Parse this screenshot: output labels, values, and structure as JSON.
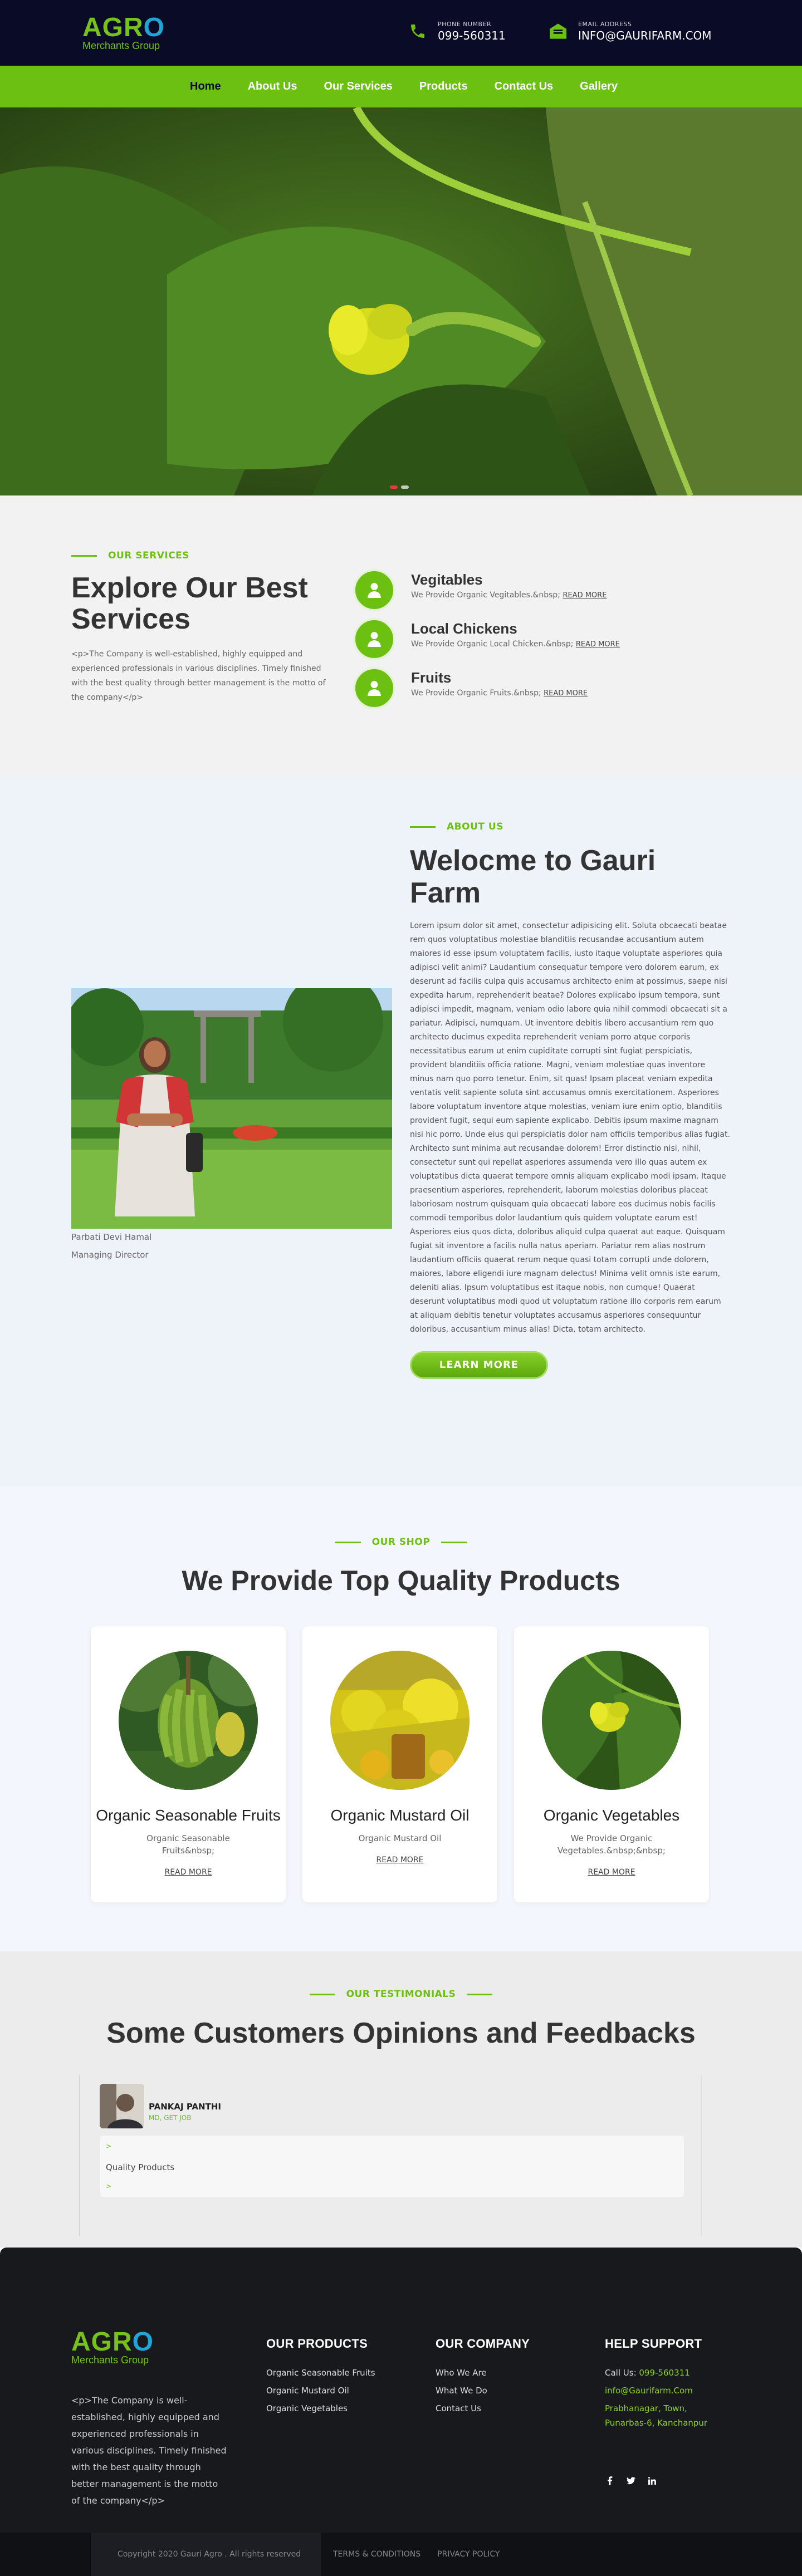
{
  "brand": {
    "logo_letters": [
      "AGR",
      "O"
    ],
    "logo_sub": "Merchants Group",
    "green": "#6cc012",
    "navy": "#0a0b26"
  },
  "header": {
    "phone_label": "PHONE NUMBER",
    "phone_value": "099-560311",
    "email_label": "EMAIL ADDRESS",
    "email_value": "INFO@GAURIFARM.COM"
  },
  "nav": {
    "items": [
      "Home",
      "About Us",
      "Our Services",
      "Products",
      "Contact Us",
      "Gallery"
    ],
    "active": "Home"
  },
  "hero": {
    "slides": 2,
    "active_slide": 1
  },
  "services": {
    "eyebrow": "OUR SERVICES",
    "title": "Explore Our Best Services",
    "text": "<p>The Company is well-established, highly equipped and experienced professionals in various disciplines. Timely finished with the best quality through better management is the motto of the company</p>",
    "items": [
      {
        "title": "Vegitables",
        "desc": "We Provide Organic Vegitables.&nbsp;",
        "link": "READ MORE"
      },
      {
        "title": "Local Chickens",
        "desc": "We Provide Organic Local Chicken.&nbsp;",
        "link": "READ MORE"
      },
      {
        "title": "Fruits",
        "desc": "We Provide Organic Fruits.&nbsp;",
        "link": "READ MORE"
      }
    ]
  },
  "about": {
    "eyebrow": "ABOUT US",
    "title": "Welocme to Gauri Farm",
    "person_name": "Parbati Devi Hamal",
    "person_role": "Managing Director",
    "text": "Lorem ipsum dolor sit amet, consectetur adipisicing elit. Soluta obcaecati beatae rem quos voluptatibus molestiae blanditiis recusandae accusantium autem maiores id esse ipsum voluptatem facilis, iusto itaque voluptate asperiores quia adipisci velit animi? Laudantium consequatur tempore vero dolorem earum, ex deserunt ad facilis culpa quis accusamus architecto enim at possimus, saepe nisi expedita harum, reprehenderit beatae? Dolores explicabo ipsum tempora, sunt adipisci impedit, magnam, veniam odio labore quia nihil commodi obcaecati sit a pariatur. Adipisci, numquam. Ut inventore debitis libero accusantium rem quo architecto ducimus expedita reprehenderit veniam porro atque corporis necessitatibus earum ut enim cupiditate corrupti sint fugiat perspiciatis, provident blanditiis officia ratione. Magni, veniam molestiae quas inventore minus nam quo porro tenetur. Enim, sit quas! Ipsam placeat veniam expedita ventatis velit sapiente soluta sint accusamus omnis exercitationem. Asperiores labore voluptatum inventore atque molestias, veniam iure enim optio, blanditiis provident fugit, sequi eum sapiente explicabo. Debitis ipsum maxime magnam nisi hic porro. Unde eius qui perspiciatis dolor nam officiis temporibus alias fugiat. Architecto sunt minima aut recusandae dolorem! Error distinctio nisi, nihil, consectetur sunt qui repellat asperiores assumenda vero illo quas autem ex voluptatibus dicta quaerat tempore omnis aliquam explicabo modi ipsam. Itaque praesentium asperiores, reprehenderit, laborum molestias doloribus placeat laboriosam nostrum quisquam quia obcaecati labore eos ducimus nobis facilis commodi temporibus dolor laudantium quis quidem voluptate earum est! Asperiores eius quos dicta, doloribus aliquid culpa quaerat aut eaque. Quisquam fugiat sit inventore a facilis nulla natus aperiam. Pariatur rem alias nostrum laudantium officiis quaerat rerum neque quasi totam corrupti unde dolorem, maiores, labore eligendi iure magnam delectus! Minima velit omnis iste earum, deleniti alias. Ipsum voluptatibus est itaque nobis, non cumque! Quaerat deserunt voluptatibus modi quod ut voluptatum ratione illo corporis rem earum at aliquam debitis tenetur voluptates accusamus asperiores consequuntur doloribus, accusantium minus alias! Dicta, totam architecto.",
    "button": "LEARN MORE"
  },
  "shop": {
    "eyebrow": "OUR SHOP",
    "title": "We Provide Top Quality Products",
    "cards": [
      {
        "title": "Organic Seasonable Fruits",
        "desc": "Organic Seasonable Fruits&nbsp;",
        "link": "READ MORE"
      },
      {
        "title": "Organic Mustard Oil",
        "desc": "Organic Mustard Oil",
        "link": "READ MORE"
      },
      {
        "title": "Organic Vegetables",
        "desc": "We Provide Organic Vegetables.&nbsp;&nbsp;",
        "link": "READ MORE"
      }
    ]
  },
  "testimonials": {
    "eyebrow": "OUR TESTIMONIALS",
    "title": "Some Customers Opinions and Feedbacks",
    "name": "PANKAJ PANTHI",
    "role": "MD, GET JOB",
    "quote_mark": ">",
    "text": "Quality Products"
  },
  "footer": {
    "about": "<p>The Company is well-established, highly equipped and experienced professionals in various disciplines. Timely finished with the best quality through better management is the motto of the company</p>",
    "products_title": "OUR PRODUCTS",
    "products": [
      "Organic Seasonable Fruits",
      "Organic Mustard Oil",
      "Organic Vegetables"
    ],
    "company_title": "OUR COMPANY",
    "company": [
      "Who We Are",
      "What We Do",
      "Contact Us"
    ],
    "help_title": "HELP SUPPORT",
    "call_label": "Call Us: ",
    "call_value": "099-560311",
    "email": "info@Gaurifarm.Com",
    "address1": "Prabhanagar, Town,",
    "address2": "Punarbas-6, Kanchanpur",
    "social": [
      "facebook-icon",
      "twitter-icon",
      "linkedin-icon"
    ],
    "copyright": "Copyright 2020 Gauri Agro . All rights reserved",
    "terms": "TERMS & CONDITIONS",
    "privacy": "PRIVACY POLICY"
  }
}
